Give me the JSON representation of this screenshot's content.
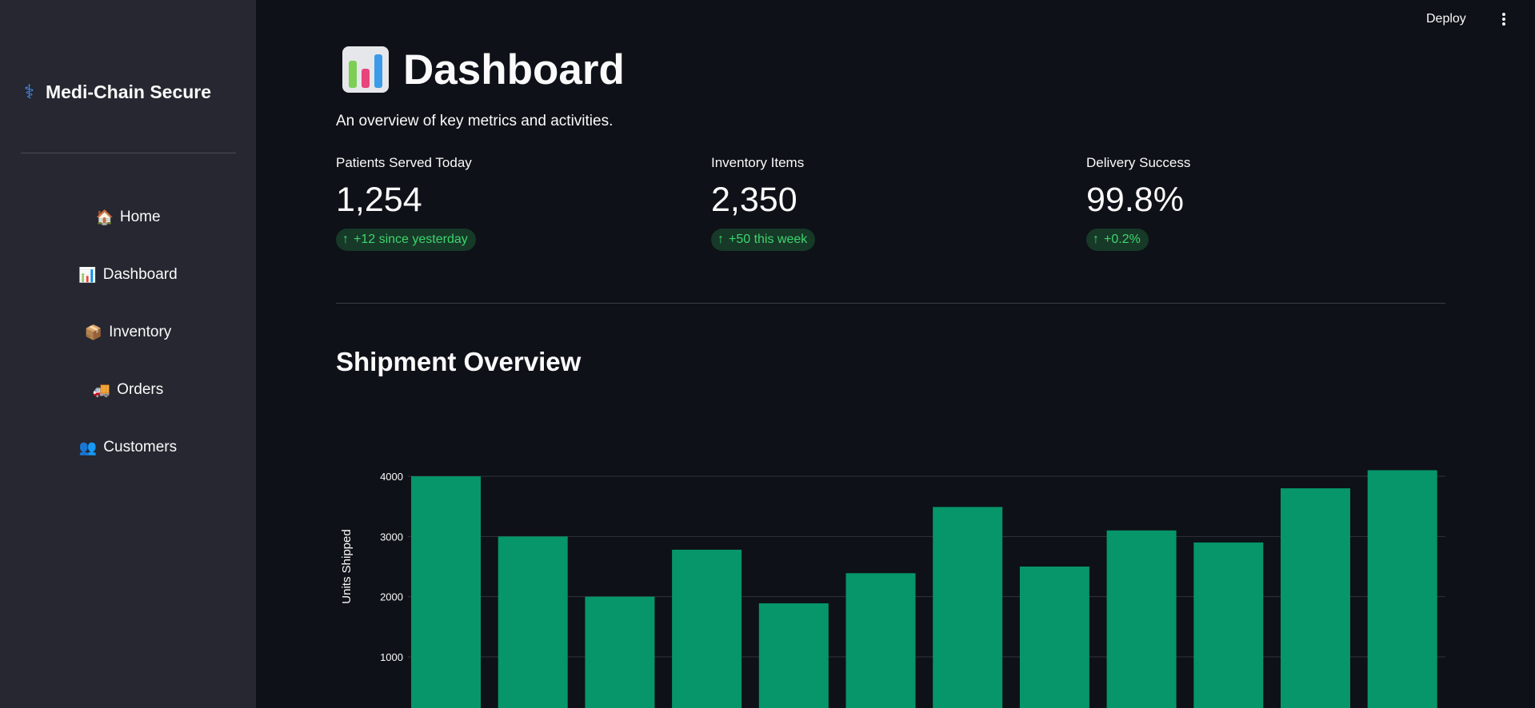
{
  "sidebar": {
    "brand": "Medi-Chain Secure",
    "brand_icon": "⚕",
    "items": [
      {
        "icon": "🏠",
        "label": "Home"
      },
      {
        "icon": "📊",
        "label": "Dashboard"
      },
      {
        "icon": "📦",
        "label": "Inventory"
      },
      {
        "icon": "🚚",
        "label": "Orders"
      },
      {
        "icon": "👥",
        "label": "Customers"
      }
    ]
  },
  "header": {
    "deploy_label": "Deploy"
  },
  "page": {
    "title": "Dashboard",
    "subtitle": "An overview of key metrics and activities.",
    "metrics": [
      {
        "label": "Patients Served Today",
        "value": "1,254",
        "delta": "+12 since yesterday"
      },
      {
        "label": "Inventory Items",
        "value": "2,350",
        "delta": "+50 this week"
      },
      {
        "label": "Delivery Success",
        "value": "99.8%",
        "delta": "+0.2%"
      }
    ],
    "section_title": "Shipment Overview"
  },
  "colors": {
    "accent_bar": "#069669",
    "delta_green": "#3dd56d"
  },
  "chart_data": {
    "type": "bar",
    "values": [
      4000,
      3000,
      2000,
      2780,
      1890,
      2390,
      3490,
      2500,
      3100,
      2900,
      3800,
      4100
    ],
    "ylabel": "Units Shipped",
    "yticks": [
      1000,
      2000,
      3000,
      4000
    ],
    "ylim": [
      0,
      4300
    ],
    "grid": true
  }
}
